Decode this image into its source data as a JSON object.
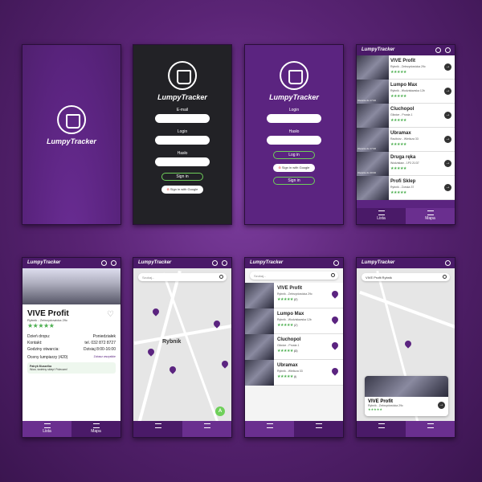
{
  "app": {
    "name": "LumpyTracker"
  },
  "login1": {
    "email": "E-mail",
    "login": "Login",
    "password": "Hasło",
    "signin": "Sign in",
    "google": "Sign in with Google"
  },
  "login2": {
    "login": "Login",
    "password": "Hasło",
    "login_btn": "Log in",
    "google": "Sign in with Google",
    "signin": "Sign in"
  },
  "tabs": {
    "list": "Lista",
    "map": "Mapa"
  },
  "shops": [
    {
      "name": "VIVE Profit",
      "addr": "Rybnik - Zebrzydowicka 29c",
      "stars": "★★★★★",
      "thumb": ""
    },
    {
      "name": "Lumpo Max",
      "addr": "Rybnik - Wodzisławska 12b",
      "stars": "★★★★★",
      "thumb": "Otwarte do 17:00"
    },
    {
      "name": "Cluchopol",
      "addr": "Gliwice - Prosta 1",
      "stars": "★★★★★",
      "thumb": ""
    },
    {
      "name": "Ubramax",
      "addr": "Racibórz - Wielicza 33",
      "stars": "★★★★★",
      "thumb": "Otwarte do 17:00"
    },
    {
      "name": "Druga ręka",
      "addr": "Wodzisław - 1P3 21/37",
      "stars": "★★★★★",
      "thumb": "Otwarte do 20:00"
    },
    {
      "name": "Profi Sklep",
      "addr": "Rybnik - Żorska 37",
      "stars": "★★★★★",
      "thumb": ""
    }
  ],
  "shops2": [
    {
      "name": "VIVE Profit",
      "addr": "Rybnik - Zebrzydowicka 29c",
      "stars": "★★★★★",
      "count": "(57)"
    },
    {
      "name": "Lumpo Max",
      "addr": "Rybnik - Wodzisławska 12b",
      "stars": "★★★★★",
      "count": "(17)"
    },
    {
      "name": "Cluchopol",
      "addr": "Gliwice - Prosta 1",
      "stars": "★★★★★",
      "count": "(82)"
    },
    {
      "name": "Ubramax",
      "addr": "Rybnik - Wielicza 33",
      "stars": "★★★★★",
      "count": "(4)"
    }
  ],
  "detail": {
    "title": "VIVE Profit",
    "addr": "Rybnik - Zebrzydowicka 29c",
    "stars": "★★★★★",
    "delivery_k": "Dzień dropu:",
    "delivery_v": "Poniedziałek",
    "contact_k": "Kontakt:",
    "contact_v": "tel. 032 872 8727",
    "hours_k": "Godziny otwarcia:",
    "hours_v": "Dzisiaj 8:00-16:00",
    "ratings": "Oceny lumpiarzy (420)",
    "see_all": "Zobacz wszystkie",
    "reviewer": "Patryk Muszelka",
    "review": "Wow, świetny sklep! Polecam!"
  },
  "map": {
    "search_placeholder": "Szukaj...",
    "city": "Rybnik",
    "avatar_letter": "A"
  },
  "map2": {
    "search_value": "VIVE Profit Rybnik",
    "card_title": "VIVE Profit",
    "card_addr": "Rybnik - Zebrzydowicka 29c",
    "stars": "★★★★★"
  },
  "colors": {
    "brand": "#5b2480",
    "accent": "#6fd05a"
  }
}
